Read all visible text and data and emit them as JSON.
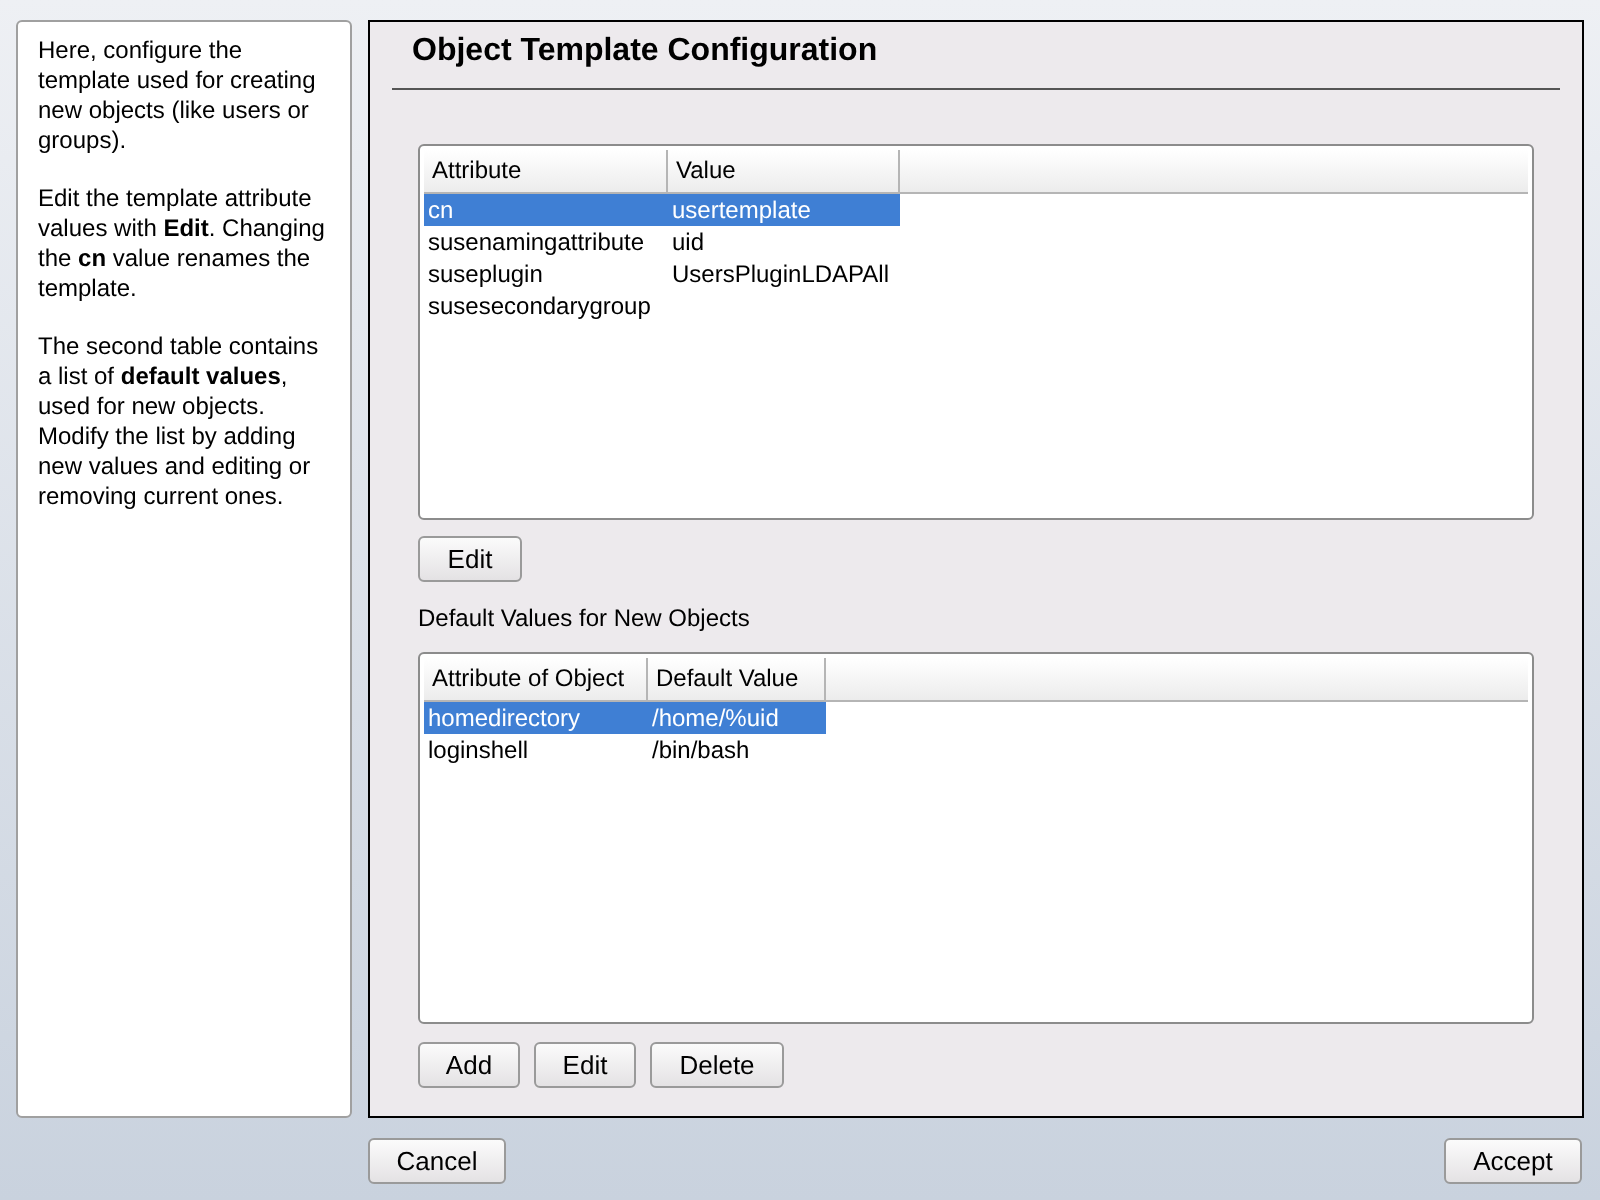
{
  "help": [
    "Here, configure the template used for creating new objects (like users or groups).",
    "Edit the template attribute values with **Edit**. Changing the **cn** value renames the template.",
    "The second table contains a list of **default values**, used for new objects. Modify the list by adding new values and editing or removing current ones."
  ],
  "title": "Object Template Configuration",
  "attributes_table": {
    "columns": [
      "Attribute",
      "Value"
    ],
    "rows": [
      {
        "cells": [
          "cn",
          "usertemplate"
        ],
        "selected": true
      },
      {
        "cells": [
          "susenamingattribute",
          "uid"
        ],
        "selected": false
      },
      {
        "cells": [
          "suseplugin",
          "UsersPluginLDAPAll"
        ],
        "selected": false
      },
      {
        "cells": [
          "susesecondarygroup",
          ""
        ],
        "selected": false
      }
    ]
  },
  "attributes_buttons": [
    "Edit"
  ],
  "defaults_label": "Default Values for New Objects",
  "defaults_table": {
    "columns": [
      "Attribute of Object",
      "Default Value"
    ],
    "rows": [
      {
        "cells": [
          "homedirectory",
          "/home/%uid"
        ],
        "selected": true
      },
      {
        "cells": [
          "loginshell",
          "/bin/bash"
        ],
        "selected": false
      }
    ]
  },
  "defaults_buttons": [
    "Add",
    "Edit",
    "Delete"
  ],
  "footer_buttons": [
    "Cancel",
    "Accept"
  ]
}
